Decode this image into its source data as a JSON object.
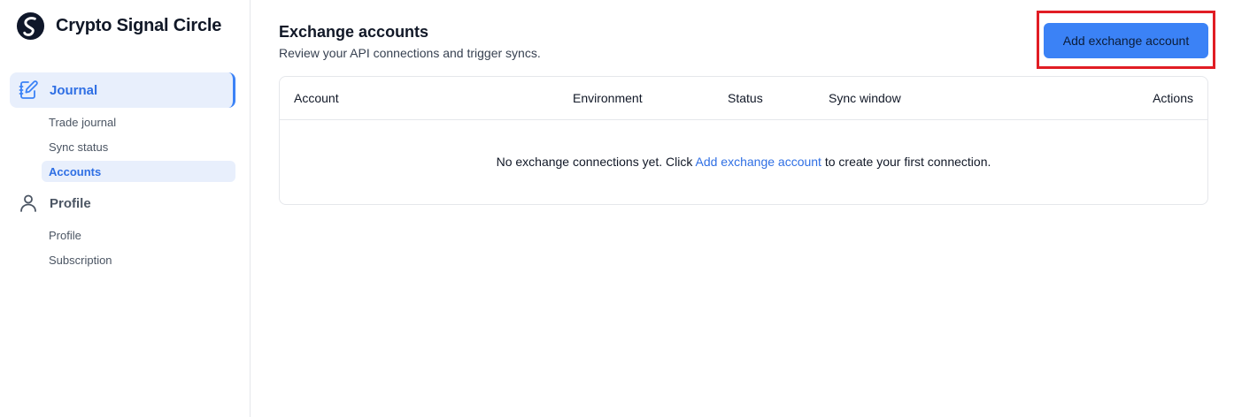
{
  "brand": {
    "name": "Crypto Signal Circle",
    "logo_icon": "brand-logo-icon"
  },
  "sidebar": {
    "journal": {
      "label": "Journal",
      "icon": "notebook-edit-icon",
      "items": [
        {
          "label": "Trade journal"
        },
        {
          "label": "Sync status"
        },
        {
          "label": "Accounts",
          "active": true
        }
      ]
    },
    "profile": {
      "label": "Profile",
      "icon": "user-icon",
      "items": [
        {
          "label": "Profile"
        },
        {
          "label": "Subscription"
        }
      ]
    }
  },
  "main": {
    "title": "Exchange accounts",
    "subtitle": "Review your API connections and trigger syncs.",
    "add_button_label": "Add exchange account",
    "table": {
      "columns": [
        "Account",
        "Environment",
        "Status",
        "Sync window",
        "Actions"
      ],
      "empty_prefix": "No exchange connections yet. Click ",
      "empty_link": "Add exchange account",
      "empty_suffix": " to create your first connection."
    }
  },
  "colors": {
    "accent": "#3b82f6",
    "accent_text": "#2f6fe4",
    "active_bg": "#e8effc",
    "highlight_border": "#e11d24"
  }
}
